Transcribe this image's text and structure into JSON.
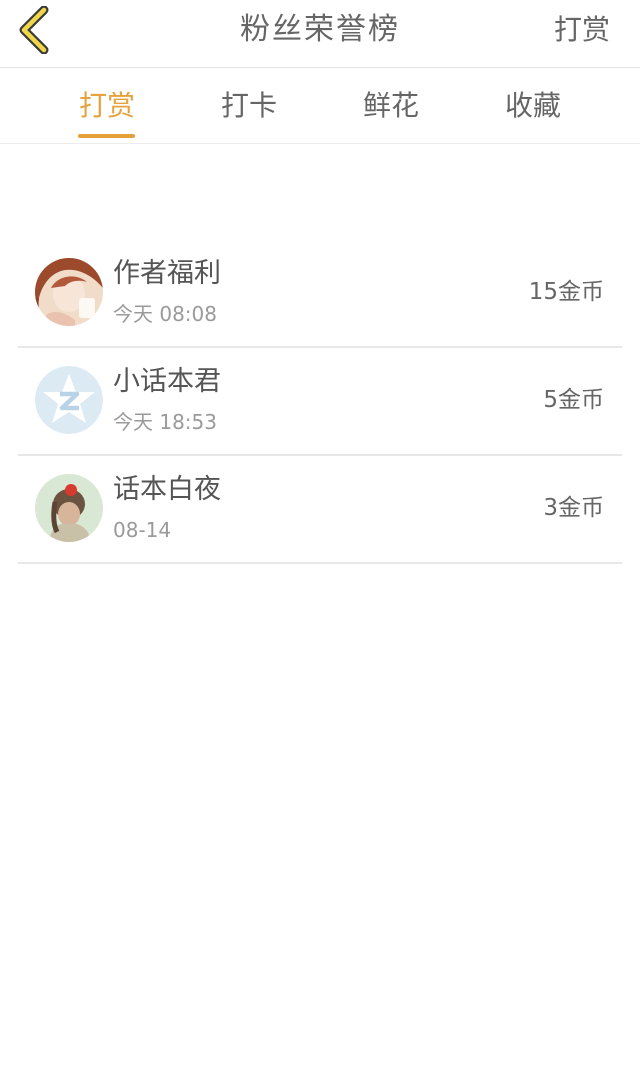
{
  "header": {
    "title": "粉丝荣誉榜",
    "action_label": "打赏",
    "back_icon": "chevron-left-icon"
  },
  "tabs": [
    {
      "label": "打赏",
      "active": true
    },
    {
      "label": "打卡",
      "active": false
    },
    {
      "label": "鲜花",
      "active": false
    },
    {
      "label": "收藏",
      "active": false
    }
  ],
  "colors": {
    "accent": "#e6a03a",
    "text": "#666666",
    "subtext": "#9a9a9a"
  },
  "fans": [
    {
      "name": "作者福利",
      "time": "今天 08:08",
      "amount": "15金币"
    },
    {
      "name": "小话本君",
      "time": "今天 18:53",
      "amount": "5金币"
    },
    {
      "name": "话本白夜",
      "time": "08-14",
      "amount": "3金币"
    }
  ]
}
